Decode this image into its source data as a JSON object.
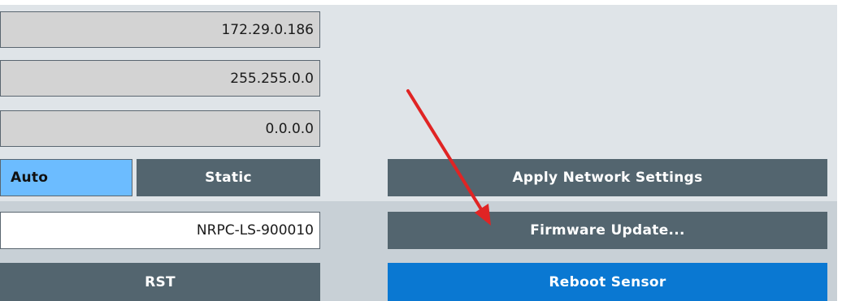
{
  "network": {
    "ip_address": "172.29.0.186",
    "subnet_mask": "255.255.0.0",
    "gateway": "0.0.0.0",
    "mode_auto_label": "Auto",
    "mode_static_label": "Static",
    "apply_label": "Apply Network Settings"
  },
  "device": {
    "hostname": "NRPC-LS-900010",
    "firmware_update_label": "Firmware Update...",
    "rst_label": "RST",
    "reboot_label": "Reboot Sensor"
  },
  "colors": {
    "button": "#53656f",
    "auto_selected": "#6cbcff",
    "reboot_button": "#0a78d2",
    "annotation_arrow": "#e02424"
  },
  "icons": {
    "annotation": "red-arrow-icon"
  }
}
